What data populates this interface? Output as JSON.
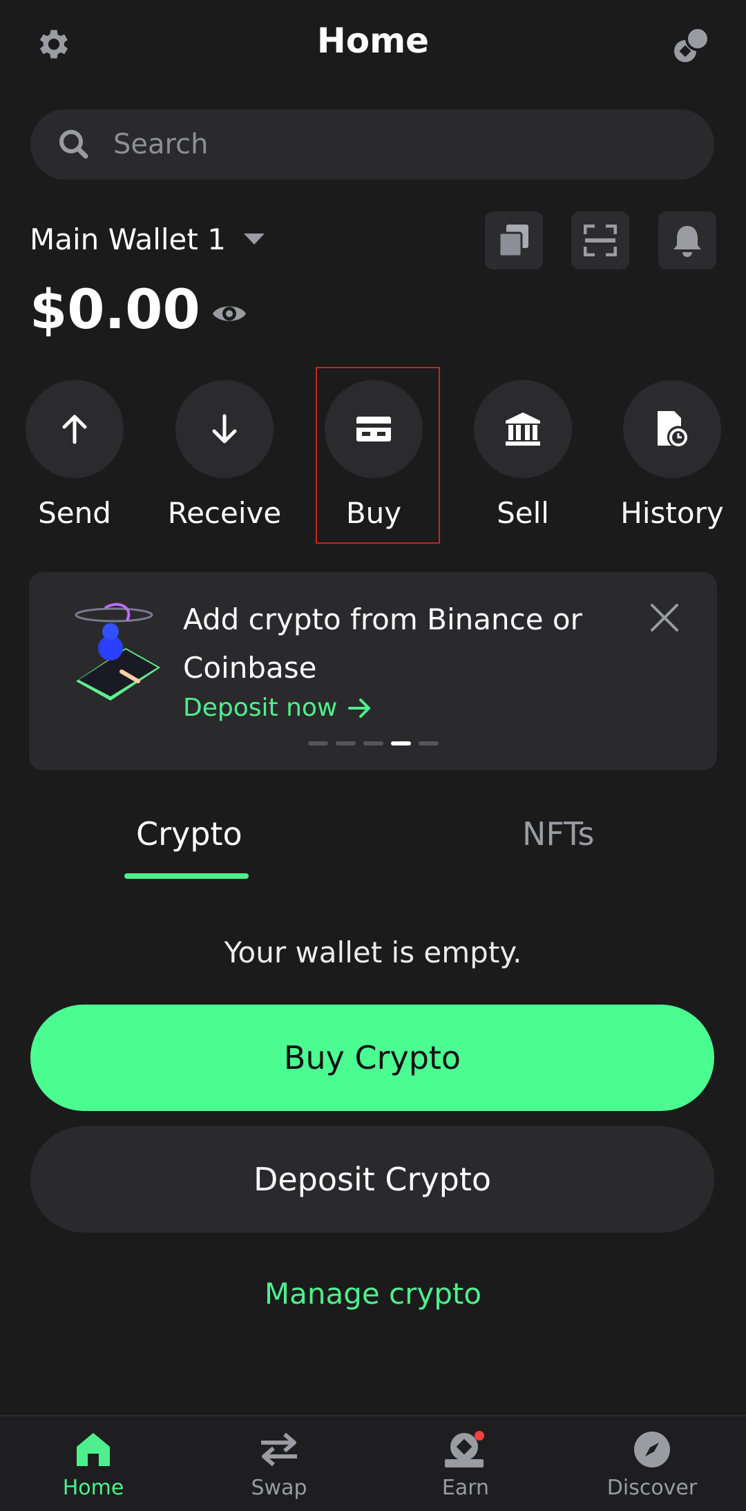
{
  "header": {
    "title": "Home",
    "settings_icon": "gear-icon",
    "connect_icon": "link-icon"
  },
  "search": {
    "placeholder": "Search"
  },
  "wallet": {
    "name": "Main Wallet 1",
    "balance": "$0.00",
    "tool_icons": [
      "copy-icon",
      "scan-icon",
      "bell-icon"
    ]
  },
  "actions": [
    {
      "label": "Send",
      "icon": "arrow-up-icon"
    },
    {
      "label": "Receive",
      "icon": "arrow-down-icon"
    },
    {
      "label": "Buy",
      "icon": "card-icon"
    },
    {
      "label": "Sell",
      "icon": "bank-icon"
    },
    {
      "label": "History",
      "icon": "history-icon"
    }
  ],
  "banner": {
    "text": "Add crypto from Binance or Coinbase",
    "link": "Deposit now",
    "page_count": 5,
    "active_page": 4
  },
  "tabs": [
    {
      "label": "Crypto",
      "active": true
    },
    {
      "label": "NFTs",
      "active": false
    }
  ],
  "content": {
    "empty_message": "Your wallet is empty.",
    "buy_button": "Buy Crypto",
    "deposit_button": "Deposit Crypto",
    "manage_link": "Manage crypto"
  },
  "bottom_nav": [
    {
      "label": "Home",
      "active": true
    },
    {
      "label": "Swap",
      "active": false
    },
    {
      "label": "Earn",
      "active": false,
      "badge": true
    },
    {
      "label": "Discover",
      "active": false
    }
  ],
  "colors": {
    "accent": "#4bfd91",
    "background": "#1b1b1c",
    "surface": "#2a2a2d"
  }
}
